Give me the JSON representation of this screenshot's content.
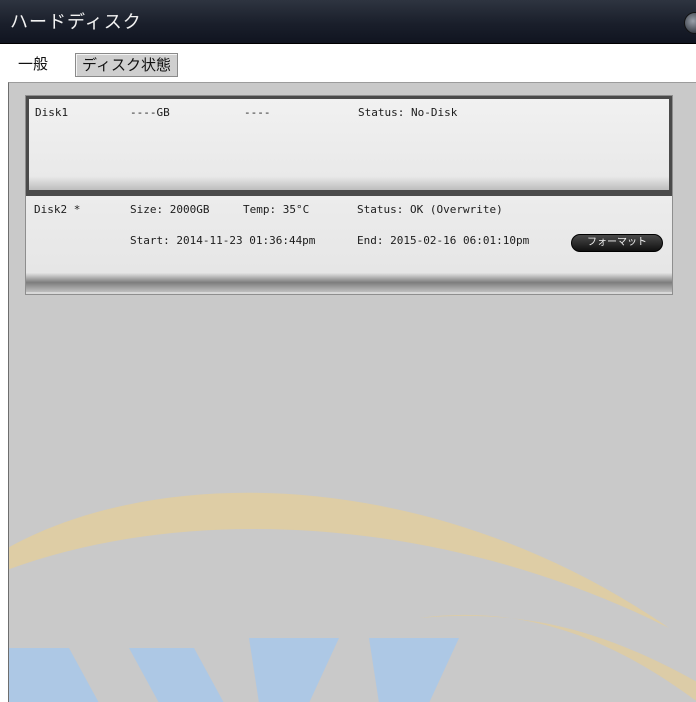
{
  "window": {
    "title": "ハードディスク"
  },
  "tabs": [
    {
      "label": "一般"
    },
    {
      "label": "ディスク状態"
    }
  ],
  "disks": [
    {
      "name": "Disk1",
      "size": "----GB",
      "temp": "----",
      "status": "Status: No-Disk"
    },
    {
      "name": "Disk2 *",
      "size": "Size: 2000GB",
      "temp": "Temp: 35°C",
      "status": "Status: OK (Overwrite)",
      "start": "Start: 2014-11-23 01:36:44pm",
      "end": "End: 2015-02-16 06:01:10pm",
      "format_label": "フォーマット"
    }
  ],
  "colors": {
    "titlebar": "#1a1f2b",
    "panel": "#c9c9c9",
    "watermark_orange": "#f0c070",
    "watermark_blue": "#9ec4ea"
  },
  "icons": {
    "window_control": "close-icon"
  }
}
